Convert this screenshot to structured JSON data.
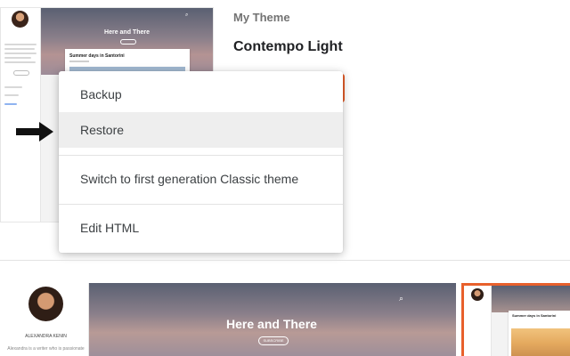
{
  "preview": {
    "blog_title": "Here and There",
    "post_title": "Summer days in Santorini",
    "search_icon": "search-icon"
  },
  "theme": {
    "section_label": "My Theme",
    "name": "Contempo Light",
    "accent": "#e8602c"
  },
  "menu": {
    "items": [
      {
        "label": "Backup"
      },
      {
        "label": "Restore"
      },
      {
        "label": "Switch to first generation Classic theme"
      },
      {
        "label": "Edit HTML"
      }
    ],
    "highlighted_index": 1
  },
  "annotation": {
    "icon": "right-arrow-icon"
  },
  "bottom_gallery": {
    "blog_title": "Here and There",
    "subscribe_label": "SUBSCRIBE",
    "author_name": "ALEXANDRA KENIN",
    "author_desc": "Alexandra is a writer who is passionate",
    "second_post_title": "Summer days in Santorini"
  }
}
